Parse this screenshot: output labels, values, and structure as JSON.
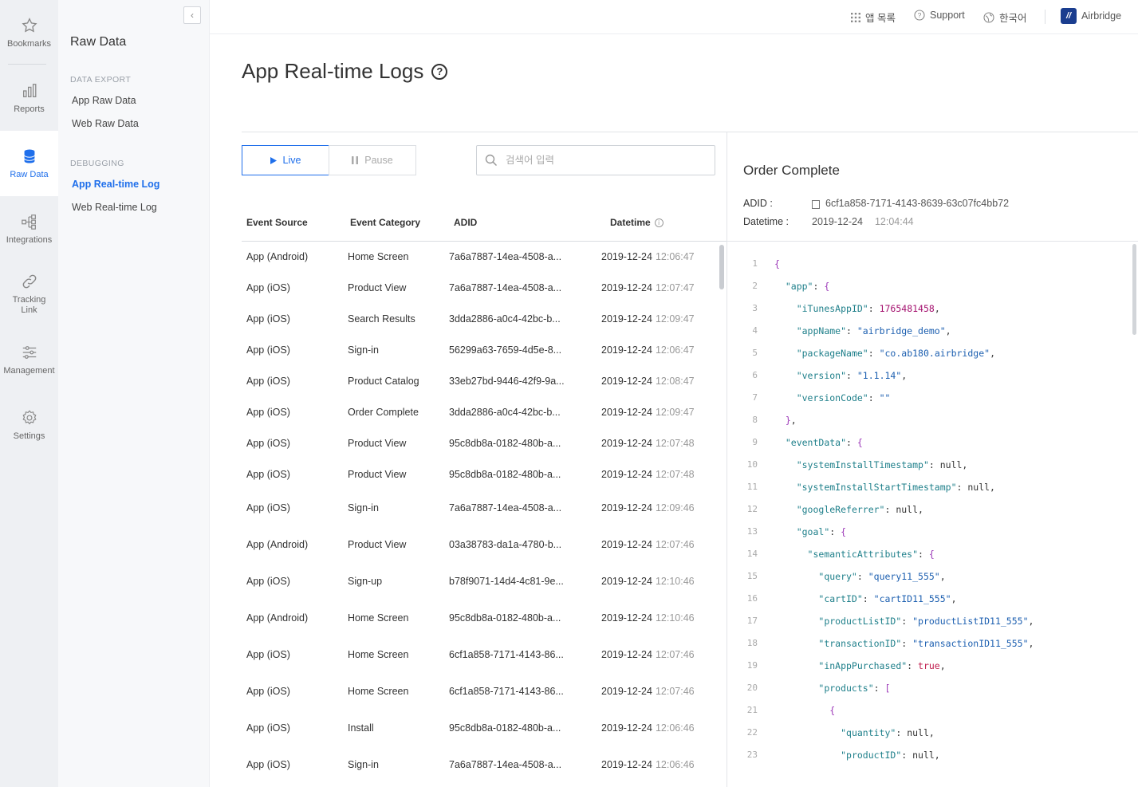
{
  "rail": {
    "items": [
      {
        "label": "Bookmarks",
        "icon": "star-icon"
      },
      {
        "label": "Reports",
        "icon": "bar-chart-icon"
      },
      {
        "label": "Raw Data",
        "icon": "database-icon"
      },
      {
        "label": "Integrations",
        "icon": "integrations-icon"
      },
      {
        "label": "Tracking Link",
        "icon": "link-icon"
      },
      {
        "label": "Management",
        "icon": "sliders-icon"
      },
      {
        "label": "Settings",
        "icon": "gear-icon"
      }
    ],
    "active": "Raw Data"
  },
  "sidebar": {
    "title": "Raw Data",
    "sections": [
      {
        "heading": "DATA EXPORT",
        "links": [
          "App Raw Data",
          "Web Raw Data"
        ]
      },
      {
        "heading": "DEBUGGING",
        "links": [
          "App Real-time Log",
          "Web Real-time Log"
        ]
      }
    ],
    "active_link": "App Real-time Log"
  },
  "topbar": {
    "apps": "앱 목록",
    "support": "Support",
    "language": "한국어",
    "brand": "Airbridge"
  },
  "page": {
    "title": "App Real-time Logs"
  },
  "controls": {
    "live": "Live",
    "pause": "Pause",
    "search_placeholder": "검색어 입력",
    "search_value": ""
  },
  "table": {
    "columns": [
      "Event Source",
      "Event Category",
      "ADID",
      "Datetime"
    ],
    "rows": [
      {
        "source": "App (Android)",
        "category": "Home Screen",
        "adid": "7a6a7887-14ea-4508-a...",
        "date": "2019-12-24",
        "time": "12:06:47"
      },
      {
        "source": "App (iOS)",
        "category": "Product View",
        "adid": "7a6a7887-14ea-4508-a...",
        "date": "2019-12-24",
        "time": "12:07:47"
      },
      {
        "source": "App (iOS)",
        "category": "Search Results",
        "adid": "3dda2886-a0c4-42bc-b...",
        "date": "2019-12-24",
        "time": "12:09:47"
      },
      {
        "source": "App (iOS)",
        "category": "Sign-in",
        "adid": "56299a63-7659-4d5e-8...",
        "date": "2019-12-24",
        "time": "12:06:47"
      },
      {
        "source": "App (iOS)",
        "category": "Product Catalog",
        "adid": "33eb27bd-9446-42f9-9a...",
        "date": "2019-12-24",
        "time": "12:08:47"
      },
      {
        "source": "App (iOS)",
        "category": "Order Complete",
        "adid": "3dda2886-a0c4-42bc-b...",
        "date": "2019-12-24",
        "time": "12:09:47"
      },
      {
        "source": "App (iOS)",
        "category": "Product View",
        "adid": "95c8db8a-0182-480b-a...",
        "date": "2019-12-24",
        "time": "12:07:48"
      },
      {
        "source": "App (iOS)",
        "category": "Product View",
        "adid": "95c8db8a-0182-480b-a...",
        "date": "2019-12-24",
        "time": "12:07:48"
      },
      {
        "source": "App (iOS)",
        "category": "Sign-in",
        "adid": "7a6a7887-14ea-4508-a...",
        "date": "2019-12-24",
        "time": "12:09:46"
      },
      {
        "source": "App (Android)",
        "category": "Product View",
        "adid": "03a38783-da1a-4780-b...",
        "date": "2019-12-24",
        "time": "12:07:46"
      },
      {
        "source": "App (iOS)",
        "category": "Sign-up",
        "adid": "b78f9071-14d4-4c81-9e...",
        "date": "2019-12-24",
        "time": "12:10:46"
      },
      {
        "source": "App (Android)",
        "category": "Home Screen",
        "adid": "95c8db8a-0182-480b-a...",
        "date": "2019-12-24",
        "time": "12:10:46"
      },
      {
        "source": "App (iOS)",
        "category": "Home Screen",
        "adid": "6cf1a858-7171-4143-86...",
        "date": "2019-12-24",
        "time": "12:07:46"
      },
      {
        "source": "App (iOS)",
        "category": "Home Screen",
        "adid": "6cf1a858-7171-4143-86...",
        "date": "2019-12-24",
        "time": "12:07:46"
      },
      {
        "source": "App (iOS)",
        "category": "Install",
        "adid": "95c8db8a-0182-480b-a...",
        "date": "2019-12-24",
        "time": "12:06:46"
      },
      {
        "source": "App (iOS)",
        "category": "Sign-in",
        "adid": "7a6a7887-14ea-4508-a...",
        "date": "2019-12-24",
        "time": "12:06:46"
      }
    ]
  },
  "detail": {
    "title": "Order Complete",
    "adid_label": "ADID :",
    "adid": "6cf1a858-7171-4143-8639-63c07fc4bb72",
    "datetime_label": "Datetime :",
    "date": "2019-12-24",
    "time": "12:04:44",
    "code_lines": [
      [
        [
          "p",
          "{"
        ]
      ],
      [
        [
          "i",
          "  "
        ],
        [
          "k",
          "\"app\""
        ],
        [
          "t",
          ": "
        ],
        [
          "p",
          "{"
        ]
      ],
      [
        [
          "i",
          "    "
        ],
        [
          "k",
          "\"iTunesAppID\""
        ],
        [
          "t",
          ": "
        ],
        [
          "n",
          "1765481458"
        ],
        [
          "t",
          ","
        ]
      ],
      [
        [
          "i",
          "    "
        ],
        [
          "k",
          "\"appName\""
        ],
        [
          "t",
          ": "
        ],
        [
          "s",
          "\"airbridge_demo\""
        ],
        [
          "t",
          ","
        ]
      ],
      [
        [
          "i",
          "    "
        ],
        [
          "k",
          "\"packageName\""
        ],
        [
          "t",
          ": "
        ],
        [
          "s",
          "\"co.ab180.airbridge\""
        ],
        [
          "t",
          ","
        ]
      ],
      [
        [
          "i",
          "    "
        ],
        [
          "k",
          "\"version\""
        ],
        [
          "t",
          ": "
        ],
        [
          "s",
          "\"1.1.14\""
        ],
        [
          "t",
          ","
        ]
      ],
      [
        [
          "i",
          "    "
        ],
        [
          "k",
          "\"versionCode\""
        ],
        [
          "t",
          ": "
        ],
        [
          "s",
          "\"\""
        ]
      ],
      [
        [
          "i",
          "  "
        ],
        [
          "p",
          "}"
        ],
        [
          "t",
          ","
        ]
      ],
      [
        [
          "i",
          "  "
        ],
        [
          "k",
          "\"eventData\""
        ],
        [
          "t",
          ": "
        ],
        [
          "p",
          "{"
        ]
      ],
      [
        [
          "i",
          "    "
        ],
        [
          "k",
          "\"systemInstallTimestamp\""
        ],
        [
          "t",
          ": null,"
        ]
      ],
      [
        [
          "i",
          "    "
        ],
        [
          "k",
          "\"systemInstallStartTimestamp\""
        ],
        [
          "t",
          ": null,"
        ]
      ],
      [
        [
          "i",
          "    "
        ],
        [
          "k",
          "\"googleReferrer\""
        ],
        [
          "t",
          ": null,"
        ]
      ],
      [
        [
          "i",
          "    "
        ],
        [
          "k",
          "\"goal\""
        ],
        [
          "t",
          ": "
        ],
        [
          "p",
          "{"
        ]
      ],
      [
        [
          "i",
          "      "
        ],
        [
          "k",
          "\"semanticAttributes\""
        ],
        [
          "t",
          ": "
        ],
        [
          "p",
          "{"
        ]
      ],
      [
        [
          "i",
          "        "
        ],
        [
          "k",
          "\"query\""
        ],
        [
          "t",
          ": "
        ],
        [
          "s",
          "\"query11_555\""
        ],
        [
          "t",
          ","
        ]
      ],
      [
        [
          "i",
          "        "
        ],
        [
          "k",
          "\"cartID\""
        ],
        [
          "t",
          ": "
        ],
        [
          "s",
          "\"cartID11_555\""
        ],
        [
          "t",
          ","
        ]
      ],
      [
        [
          "i",
          "        "
        ],
        [
          "k",
          "\"productListID\""
        ],
        [
          "t",
          ": "
        ],
        [
          "s",
          "\"productListID11_555\""
        ],
        [
          "t",
          ","
        ]
      ],
      [
        [
          "i",
          "        "
        ],
        [
          "k",
          "\"transactionID\""
        ],
        [
          "t",
          ": "
        ],
        [
          "s",
          "\"transactionID11_555\""
        ],
        [
          "t",
          ","
        ]
      ],
      [
        [
          "i",
          "        "
        ],
        [
          "k",
          "\"inAppPurchased\""
        ],
        [
          "t",
          ": "
        ],
        [
          "kw",
          "true"
        ],
        [
          "t",
          ","
        ]
      ],
      [
        [
          "i",
          "        "
        ],
        [
          "k",
          "\"products\""
        ],
        [
          "t",
          ": "
        ],
        [
          "p",
          "["
        ]
      ],
      [
        [
          "i",
          "          "
        ],
        [
          "p",
          "{"
        ]
      ],
      [
        [
          "i",
          "            "
        ],
        [
          "k",
          "\"quantity\""
        ],
        [
          "t",
          ": null,"
        ]
      ],
      [
        [
          "i",
          "            "
        ],
        [
          "k",
          "\"productID\""
        ],
        [
          "t",
          ": null,"
        ]
      ]
    ]
  },
  "colors": {
    "accent": "#1f6feb",
    "brand": "#1a3d8f",
    "json_key": "#1e7f8a",
    "json_string": "#1c5fb0",
    "json_number": "#a4106e",
    "json_bracket": "#9b36b7",
    "json_boolean": "#c01b4d"
  }
}
